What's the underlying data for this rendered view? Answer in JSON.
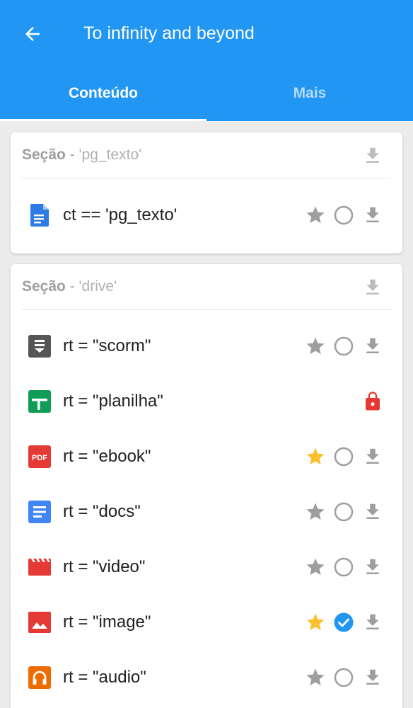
{
  "header": {
    "title": "To infinity and beyond",
    "color": "#2196f3"
  },
  "tabs": [
    {
      "label": "Conteúdo",
      "active": true
    },
    {
      "label": "Mais",
      "active": false
    }
  ],
  "sections": [
    {
      "label": "Seção",
      "separator": " - ",
      "name": "'pg_texto'",
      "items": [
        {
          "text": "ct == 'pg_texto'",
          "icon": "google-doc-icon",
          "starred": false,
          "checked": false,
          "locked": false
        }
      ]
    },
    {
      "label": "Seção",
      "separator": " - ",
      "name": "'drive'",
      "items": [
        {
          "text": "rt = \"scorm\"",
          "icon": "scorm-icon",
          "starred": false,
          "checked": false,
          "locked": false
        },
        {
          "text": "rt = \"planilha\"",
          "icon": "spreadsheet-icon",
          "locked": true
        },
        {
          "text": "rt = \"ebook\"",
          "icon": "pdf-icon",
          "starred": true,
          "checked": false,
          "locked": false
        },
        {
          "text": "rt = \"docs\"",
          "icon": "docs-icon",
          "starred": false,
          "checked": false,
          "locked": false
        },
        {
          "text": "rt = \"video\"",
          "icon": "video-icon",
          "starred": false,
          "checked": false,
          "locked": false
        },
        {
          "text": "rt = \"image\"",
          "icon": "image-icon",
          "starred": true,
          "checked": true,
          "locked": false
        },
        {
          "text": "rt = \"audio\"",
          "icon": "audio-icon",
          "starred": false,
          "checked": false,
          "locked": false
        }
      ]
    }
  ],
  "colors": {
    "star_active": "#fbc02d",
    "star_inactive": "#9e9e9e",
    "check_active": "#2196f3",
    "lock": "#e53935"
  }
}
